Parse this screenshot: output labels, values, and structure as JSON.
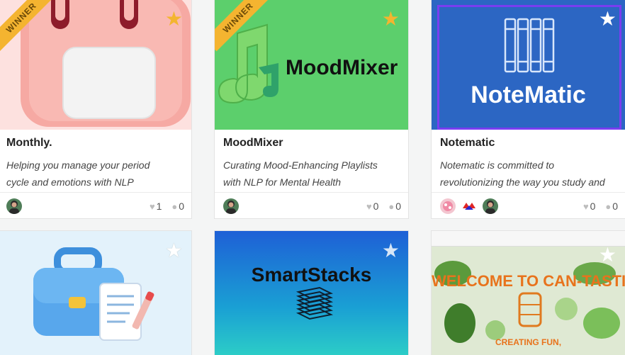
{
  "cards": [
    {
      "title": "Monthly.",
      "desc1": "Helping you manage your period",
      "desc2": "cycle and emotions with NLP",
      "likes": "1",
      "comments": "0",
      "ribbon": "WINNER",
      "star": "★",
      "thumb_bg": "#fde1df"
    },
    {
      "title": "MoodMixer",
      "desc1": "Curating Mood-Enhancing Playlists",
      "desc2": "with NLP for Mental Health",
      "likes": "0",
      "comments": "0",
      "ribbon": "WINNER",
      "star": "★",
      "thumb_text": "MoodMixer",
      "thumb_bg": "#5ccf6c"
    },
    {
      "title": "Notematic",
      "desc1": "Notematic is committed to",
      "desc2": "revolutionizing the way you study and",
      "likes": "0",
      "comments": "0",
      "star": "★",
      "thumb_text": "NoteMatic",
      "thumb_bg": "#2c66c3"
    },
    {
      "star": "★",
      "thumb_bg": "#e3f2fb"
    },
    {
      "star": "★",
      "thumb_text": "SmartStacks",
      "thumb_bg": "#1aa0d4"
    },
    {
      "star": "★",
      "thumb_text": "WELCOME TO CAN-TASTIC",
      "thumb_subtext": "CREATING FUN,",
      "thumb_bg": "#dfe9d3"
    }
  ],
  "icons": {
    "like": "heart-icon",
    "comment": "comment-icon",
    "star": "star-icon"
  },
  "colors": {
    "star_active": "#f3b52f",
    "star_inactive": "#ffffff",
    "ribbon": "#f4b430"
  }
}
